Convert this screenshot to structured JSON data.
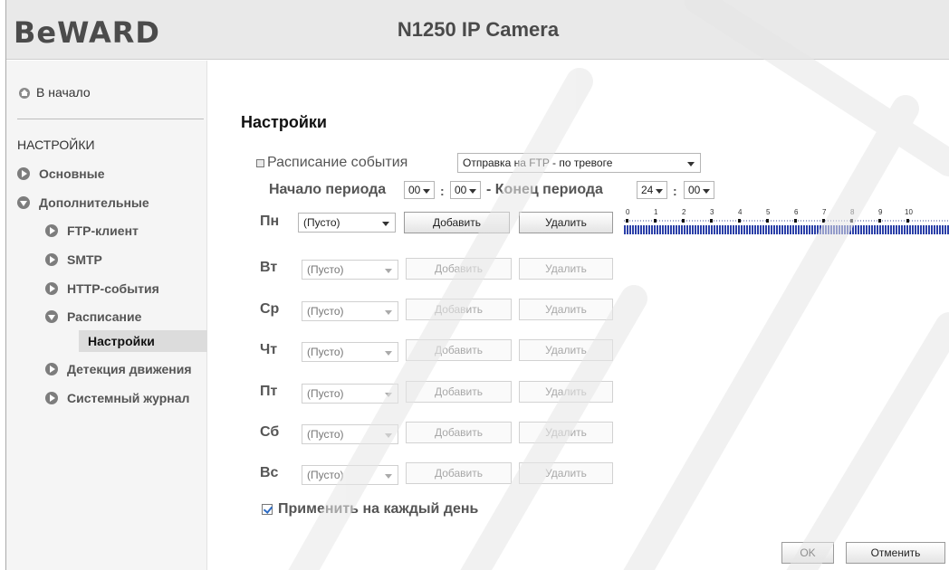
{
  "header": {
    "logo": "BeWARD",
    "title": "N1250 IP Camera"
  },
  "sidebar": {
    "home_label": "В начало",
    "section_title": "НАСТРОЙКИ",
    "items": [
      {
        "label": "Основные",
        "icon": "arrow-right-icon"
      },
      {
        "label": "Дополнительные",
        "icon": "arrow-down-icon"
      },
      {
        "label": "FTP-клиент",
        "icon": "arrow-right-icon"
      },
      {
        "label": "SMTP",
        "icon": "arrow-right-icon"
      },
      {
        "label": "HTTP-события",
        "icon": "arrow-right-icon"
      },
      {
        "label": "Расписание",
        "icon": "arrow-down-icon"
      },
      {
        "label": "Настройки",
        "active": true
      },
      {
        "label": "Детекция движения",
        "icon": "arrow-right-icon"
      },
      {
        "label": "Системный журнал",
        "icon": "arrow-right-icon"
      }
    ]
  },
  "main": {
    "title": "Настройки",
    "schedule_label": "Расписание события",
    "schedule_value": "Отправка на FTP - по тревоге",
    "period_start_label": "Начало периода",
    "period_end_label": "- Конец периода",
    "start_hour": "00",
    "start_min": "00",
    "end_hour": "24",
    "end_min": "00",
    "colon": ":",
    "days": [
      {
        "label": "Пн",
        "value": "(Пусто)",
        "enabled": true
      },
      {
        "label": "Вт",
        "value": "(Пусто)",
        "enabled": false
      },
      {
        "label": "Ср",
        "value": "(Пусто)",
        "enabled": false
      },
      {
        "label": "Чт",
        "value": "(Пусто)",
        "enabled": false
      },
      {
        "label": "Пт",
        "value": "(Пусто)",
        "enabled": false
      },
      {
        "label": "Сб",
        "value": "(Пусто)",
        "enabled": false
      },
      {
        "label": "Вс",
        "value": "(Пусто)",
        "enabled": false
      }
    ],
    "add_label": "Добавить",
    "delete_label": "Удалить",
    "timeline_hours": [
      "0",
      "1",
      "2",
      "3",
      "4",
      "5",
      "6",
      "7",
      "8",
      "9",
      "10"
    ],
    "apply_all_label": "Применить на каждый день",
    "apply_all_checked": true,
    "ok_label": "OK",
    "cancel_label": "Отменить"
  }
}
